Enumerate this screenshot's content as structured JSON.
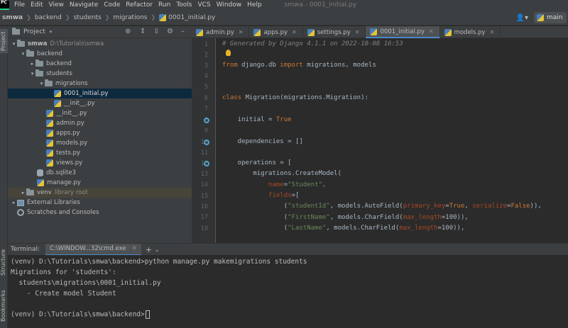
{
  "menubar": {
    "items": [
      "File",
      "Edit",
      "View",
      "Navigate",
      "Code",
      "Refactor",
      "Run",
      "Tools",
      "VCS",
      "Window",
      "Help"
    ],
    "window_title": "smwa - 0001_initial.py"
  },
  "breadcrumbs": [
    "smwa",
    "backend",
    "students",
    "migrations",
    "0001_initial.py"
  ],
  "branch": "main",
  "sidebar": {
    "project_tab": "Project",
    "structure_tab": "Structure",
    "bookmarks_tab": "Bookmarks"
  },
  "project_panel": {
    "title": "Project",
    "tree": [
      {
        "label": "smwa",
        "extra": "D:\\Tutorials\\smwa",
        "type": "folder",
        "arrow": "▾"
      },
      {
        "label": "backend",
        "type": "folder",
        "arrow": "▾"
      },
      {
        "label": "backend",
        "type": "folder",
        "arrow": "▸"
      },
      {
        "label": "students",
        "type": "folder",
        "arrow": "▾"
      },
      {
        "label": "migrations",
        "type": "folder",
        "arrow": "▾"
      },
      {
        "label": "0001_initial.py",
        "type": "py",
        "arrow": ""
      },
      {
        "label": "__init__.py",
        "type": "py",
        "arrow": ""
      },
      {
        "label": "__init__.py",
        "type": "py",
        "arrow": ""
      },
      {
        "label": "admin.py",
        "type": "py",
        "arrow": ""
      },
      {
        "label": "apps.py",
        "type": "py",
        "arrow": ""
      },
      {
        "label": "models.py",
        "type": "py",
        "arrow": ""
      },
      {
        "label": "tests.py",
        "type": "py",
        "arrow": ""
      },
      {
        "label": "views.py",
        "type": "py",
        "arrow": ""
      },
      {
        "label": "db.sqlite3",
        "type": "db",
        "arrow": ""
      },
      {
        "label": "manage.py",
        "type": "py",
        "arrow": ""
      },
      {
        "label": "venv",
        "extra": "library root",
        "type": "folder",
        "arrow": "▸"
      },
      {
        "label": "External Libraries",
        "type": "lib",
        "arrow": "▸"
      },
      {
        "label": "Scratches and Consoles",
        "type": "scratch",
        "arrow": ""
      }
    ]
  },
  "editor_tabs": [
    {
      "label": "admin.py",
      "active": false
    },
    {
      "label": "apps.py",
      "active": false
    },
    {
      "label": "settings.py",
      "active": false
    },
    {
      "label": "0001_initial.py",
      "active": true
    },
    {
      "label": "models.py",
      "active": false
    }
  ],
  "code": {
    "line_numbers": [
      "1",
      "2",
      "3",
      "4",
      "5",
      "6",
      "7",
      "8",
      "9",
      "10",
      "11",
      "12",
      "13",
      "14",
      "15",
      "16",
      "17",
      "18"
    ],
    "comment": "# Generated by Django 4.1.1 on 2022-10-08 16:53",
    "kw_from": "from",
    "module": " django.db ",
    "kw_import": "import",
    "imports": " migrations, models",
    "kw_class": "class",
    "class_decl": " Migration(migrations.Migration):",
    "initial_pre": "    initial = ",
    "kw_true": "True",
    "dependencies": "    dependencies = []",
    "operations": "    operations = [",
    "create_model": "        migrations.CreateModel(",
    "name_param": "name",
    "name_eq": "=",
    "name_val": "\"Student\"",
    "comma": ",",
    "fields_param": "fields",
    "fields_rest": "=[",
    "f1_name": "\"studentId\"",
    "f1_mid": ", models.AutoField(",
    "f1_p1": "primary_key",
    "f1_v1": "True",
    "f1_p2": "serialize",
    "f1_v2": "False",
    "f1_end": ")),",
    "f2_name": "\"FirstName\"",
    "f2_mid": ", models.CharField(",
    "f2_p": "max_length",
    "f2_v": "=100)),",
    "f3_name": "\"LastName\"",
    "f3_mid": ", models.CharField(",
    "f3_p": "max_length",
    "f3_v": "=100)),"
  },
  "terminal": {
    "label": "Terminal:",
    "tab": "C:\\WINDOW...32\\cmd.exe",
    "lines": [
      "(venv) D:\\Tutorials\\smwa\\backend>python manage.py makemigrations students",
      "Migrations for 'students':",
      "  students\\migrations\\0001_initial.py",
      "    - Create model Student",
      "",
      "(venv) D:\\Tutorials\\smwa\\backend>"
    ]
  }
}
